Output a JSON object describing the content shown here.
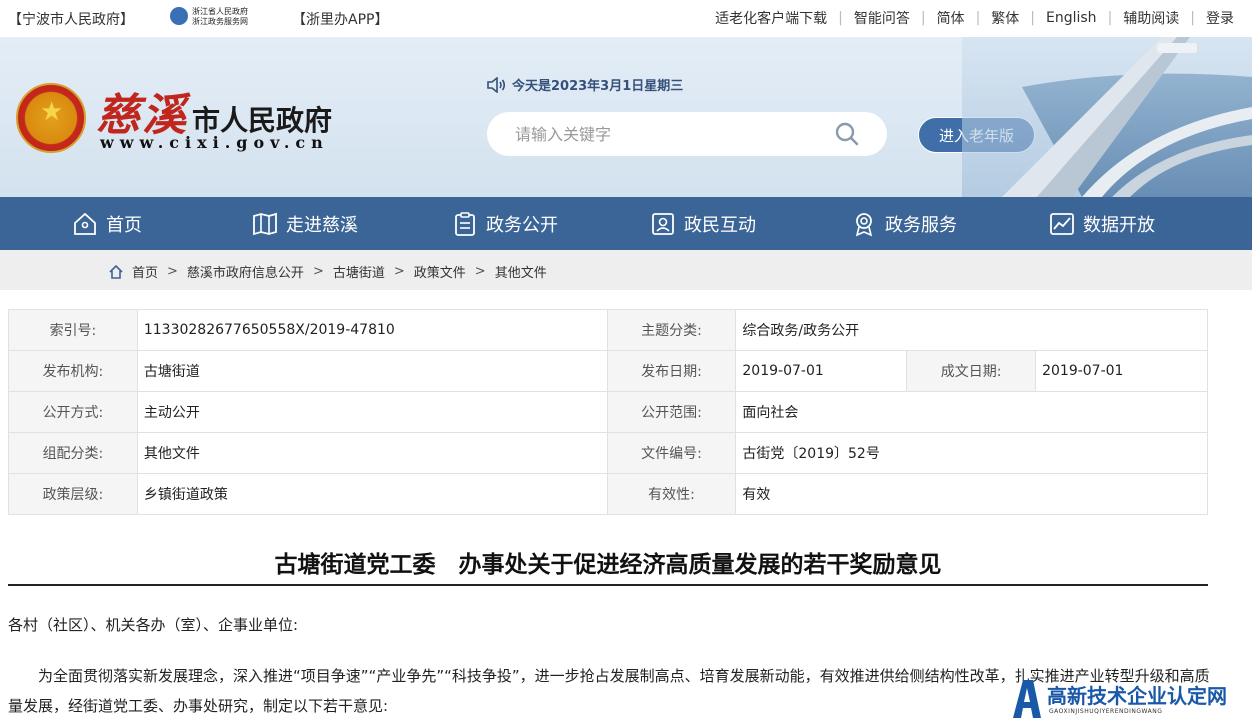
{
  "topbar": {
    "left_link": "【宁波市人民政府】",
    "zj_logo_line1": "浙江省人民政府",
    "zj_logo_line2": "浙江政务服务网",
    "app_link": "【浙里办APP】",
    "right_links": [
      "适老化客户端下载",
      "智能问答",
      "简体",
      "繁体",
      "English",
      "辅助阅读",
      "登录"
    ]
  },
  "header": {
    "city_name": "慈溪",
    "gov_name": "市人民政府",
    "url": "www.cixi.gov.cn",
    "date_text": "今天是2023年3月1日星期三",
    "search_placeholder": "请输入关键字",
    "elder_button": "进入老年版"
  },
  "nav": {
    "items": [
      {
        "label": "首页",
        "icon": "home-icon"
      },
      {
        "label": "走进慈溪",
        "icon": "map-icon"
      },
      {
        "label": "政务公开",
        "icon": "clipboard-icon"
      },
      {
        "label": "政民互动",
        "icon": "interaction-icon"
      },
      {
        "label": "政务服务",
        "icon": "service-badge-icon"
      },
      {
        "label": "数据开放",
        "icon": "chart-icon"
      }
    ]
  },
  "breadcrumb": [
    "首页",
    "慈溪市政府信息公开",
    "古塘街道",
    "政策文件",
    "其他文件"
  ],
  "info": {
    "index_label": "索引号:",
    "index_value": "11330282677650558X/2019-47810",
    "topic_label": "主题分类:",
    "topic_value": "综合政务/政务公开",
    "org_label": "发布机构:",
    "org_value": "古塘街道",
    "pubdate_label": "发布日期:",
    "pubdate_value": "2019-07-01",
    "created_label": "成文日期:",
    "created_value": "2019-07-01",
    "mode_label": "公开方式:",
    "mode_value": "主动公开",
    "scope_label": "公开范围:",
    "scope_value": "面向社会",
    "group_label": "组配分类:",
    "group_value": "其他文件",
    "docno_label": "文件编号:",
    "docno_value": "古街党〔2019〕52号",
    "level_label": "政策层级:",
    "level_value": "乡镇街道政策",
    "valid_label": "有效性:",
    "valid_value": "有效"
  },
  "article": {
    "title": "古塘街道党工委　办事处关于促进经济高质量发展的若干奖励意见",
    "greeting": "各村（社区）、机关各办（室）、企事业单位:",
    "paragraph": "为全面贯彻落实新发展理念，深入推进“项目争速”“产业争先”“科技争投”，进一步抢占发展制高点、培育发展新动能，有效推进供给侧结构性改革，扎实推进产业转型升级和高质量发展，经街道党工委、办事处研究，制定以下若干意见:"
  },
  "watermark": {
    "cn": "高新技术企业认定网",
    "en": "GAOXINJISHUQIYERENDINGWANG"
  },
  "colors": {
    "nav_bg": "#3c6597",
    "city_red": "#c0261c",
    "elder_button_bg": "#3f6ea8"
  }
}
